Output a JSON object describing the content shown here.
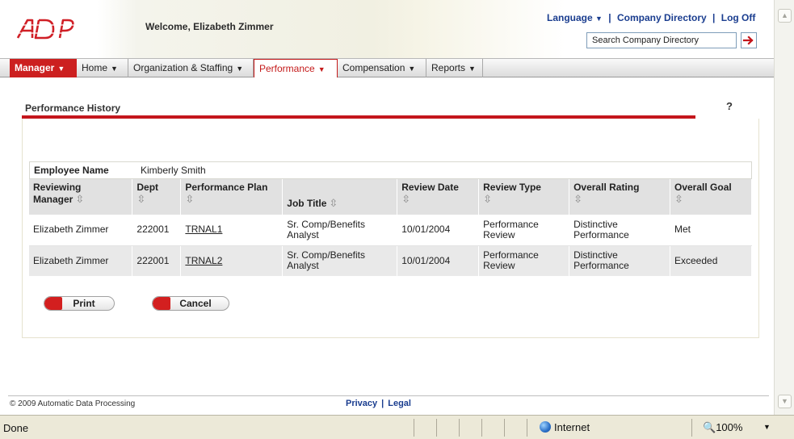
{
  "header": {
    "welcome": "Welcome, Elizabeth Zimmer",
    "links": {
      "language": "Language",
      "company_directory": "Company Directory",
      "log_off": "Log Off",
      "separator": "|"
    },
    "search": {
      "value": "Search Company Directory"
    }
  },
  "menu": {
    "manager": "Manager",
    "home": "Home",
    "organization": "Organization & Staffing",
    "performance": "Performance",
    "compensation": "Compensation",
    "reports": "Reports"
  },
  "page": {
    "title": "Performance History",
    "help": "?",
    "employee_label": "Employee Name",
    "employee_value": "Kimberly Smith"
  },
  "table": {
    "headers": {
      "manager_line1": "Reviewing",
      "manager_line2": "Manager",
      "dept": "Dept",
      "plan": "Performance Plan",
      "job": "Job Title",
      "review_date": "Review Date",
      "review_type": "Review Type",
      "overall_rating": "Overall Rating",
      "overall_goal": "Overall Goal"
    },
    "rows": [
      {
        "manager": "Elizabeth Zimmer",
        "dept": "222001",
        "plan": "TRNAL1",
        "job": "Sr. Comp/Benefits Analyst",
        "review_date": "10/01/2004",
        "review_type": "Performance Review",
        "rating": "Distinctive Performance",
        "goal": "Met"
      },
      {
        "manager": "Elizabeth Zimmer",
        "dept": "222001",
        "plan": "TRNAL2",
        "job": "Sr. Comp/Benefits Analyst",
        "review_date": "10/01/2004",
        "review_type": "Performance Review",
        "rating": "Distinctive Performance",
        "goal": "Exceeded"
      }
    ]
  },
  "buttons": {
    "print": "Print",
    "cancel": "Cancel"
  },
  "footer": {
    "copyright": "© 2009 Automatic Data Processing",
    "privacy": "Privacy",
    "legal": "Legal",
    "separator": "|"
  },
  "statusbar": {
    "status": "Done",
    "zone": "Internet",
    "zoom": "100%"
  },
  "colors": {
    "brand_red": "#cc1f1f",
    "link_blue": "#1a3d8f",
    "row_alt": "#e9e9e9"
  },
  "icons": [
    "adp-logo",
    "chevron-down-icon",
    "search-go-icon",
    "sort-icon",
    "help-icon",
    "globe-icon",
    "zoom-icon"
  ]
}
